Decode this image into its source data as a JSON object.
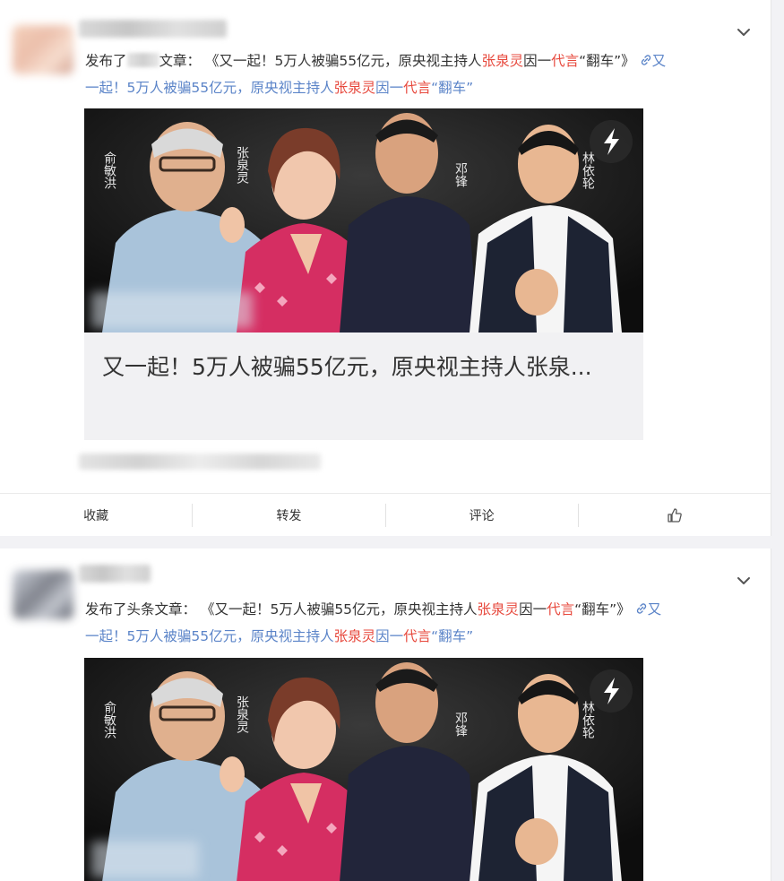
{
  "posts": [
    {
      "action_verb": "发布了",
      "action_suffix": "文章：",
      "title_open": "《又一起！5万人被骗55亿元，原央视主持人",
      "title_name": "张泉灵",
      "title_mid": "因一",
      "title_red2": "代言",
      "title_close": "“翻车”》",
      "link_line1": "又",
      "link_line2a": "一起！5万人被骗55亿元，原央视主持人",
      "link_name": "张泉灵",
      "link_mid": "因一",
      "link_red2": "代言",
      "link_close": "“翻车”",
      "card_title": "又一起！5万人被骗55亿元，原央视主持人张泉...",
      "photo_labels": [
        "俞敏洪",
        "张泉灵",
        "邓锋",
        "林依轮"
      ]
    },
    {
      "action_verb": "发布了头条文章：",
      "title_open": "《又一起！5万人被骗55亿元，原央视主持人",
      "title_name": "张泉灵",
      "title_mid": "因一",
      "title_red2": "代言",
      "title_close": "“翻车”》",
      "link_line1": "又",
      "link_line2a": "一起！5万人被骗55亿元，原央视主持人",
      "link_name": "张泉灵",
      "link_mid": "因一",
      "link_red2": "代言",
      "link_close": "“翻车”",
      "photo_labels": [
        "俞敏洪",
        "张泉灵",
        "邓锋",
        "林依轮"
      ]
    }
  ],
  "actions": {
    "collect": "收藏",
    "forward": "转发",
    "comment": "评论"
  },
  "icons": {
    "chevron": "chevron-down-icon",
    "link": "link-icon",
    "like": "thumbs-up-icon",
    "video": "lightning-icon"
  },
  "colors": {
    "link": "#5b84c8",
    "highlight": "#e7483c"
  }
}
